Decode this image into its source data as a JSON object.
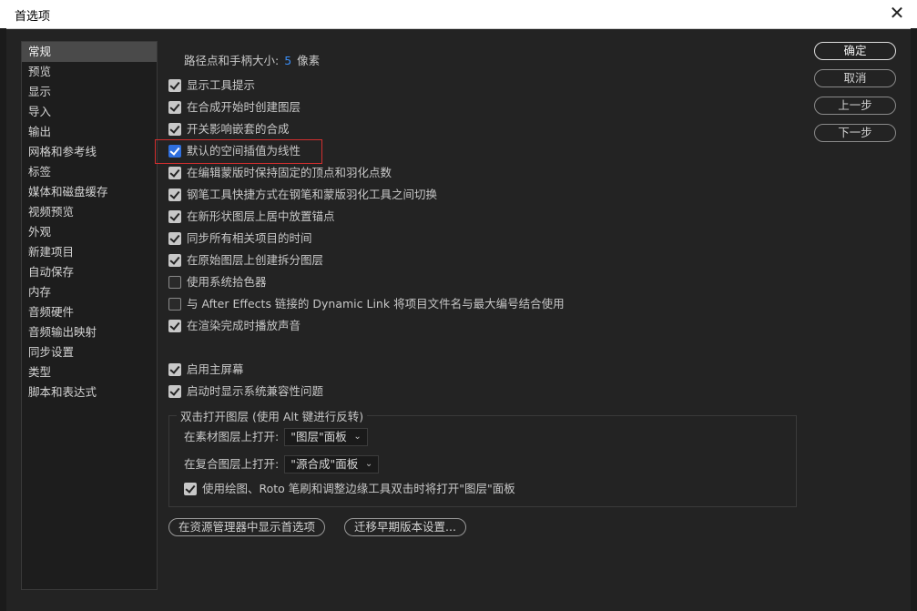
{
  "window": {
    "title": "首选项",
    "close_glyph": "✕"
  },
  "sidebar": {
    "items": [
      {
        "label": "常规",
        "selected": true
      },
      {
        "label": "预览"
      },
      {
        "label": "显示"
      },
      {
        "label": "导入"
      },
      {
        "label": "输出"
      },
      {
        "label": "网格和参考线"
      },
      {
        "label": "标签"
      },
      {
        "label": "媒体和磁盘缓存"
      },
      {
        "label": "视频预览"
      },
      {
        "label": "外观"
      },
      {
        "label": "新建项目"
      },
      {
        "label": "自动保存"
      },
      {
        "label": "内存"
      },
      {
        "label": "音频硬件"
      },
      {
        "label": "音频输出映射"
      },
      {
        "label": "同步设置"
      },
      {
        "label": "类型"
      },
      {
        "label": "脚本和表达式"
      }
    ]
  },
  "general": {
    "path_point_label": "路径点和手柄大小:",
    "path_point_value": "5",
    "path_point_unit": "像素",
    "checkboxes": [
      {
        "label": "显示工具提示",
        "checked": true
      },
      {
        "label": "在合成开始时创建图层",
        "checked": true
      },
      {
        "label": "开关影响嵌套的合成",
        "checked": true
      },
      {
        "label": "默认的空间插值为线性",
        "checked": true,
        "highlight": true
      },
      {
        "label": "在编辑蒙版时保持固定的顶点和羽化点数",
        "checked": true
      },
      {
        "label": "钢笔工具快捷方式在钢笔和蒙版羽化工具之间切换",
        "checked": true
      },
      {
        "label": "在新形状图层上居中放置锚点",
        "checked": true
      },
      {
        "label": "同步所有相关项目的时间",
        "checked": true
      },
      {
        "label": "在原始图层上创建拆分图层",
        "checked": true
      },
      {
        "label": "使用系统拾色器",
        "checked": false
      },
      {
        "label": "与 After Effects 链接的 Dynamic Link 将项目文件名与最大编号结合使用",
        "checked": false
      },
      {
        "label": "在渲染完成时播放声音",
        "checked": true
      }
    ],
    "checkboxes2": [
      {
        "label": "启用主屏幕",
        "checked": true
      },
      {
        "label": "启动时显示系统兼容性问题",
        "checked": true
      }
    ],
    "double_click_group": {
      "legend": "双击打开图层 (使用 Alt 键进行反转)",
      "footage_label": "在素材图层上打开:",
      "footage_value": "\"图层\"面板",
      "comp_label": "在复合图层上打开:",
      "comp_value": "\"源合成\"面板",
      "paint_label": "使用绘图、Roto 笔刷和调整边缘工具双击时将打开\"图层\"面板",
      "paint_checked": true
    },
    "reveal_button": "在资源管理器中显示首选项",
    "migrate_button": "迁移早期版本设置..."
  },
  "buttons": {
    "ok": "确定",
    "cancel": "取消",
    "prev": "上一步",
    "next": "下一步"
  },
  "colors": {
    "accent_blue": "#3b8ef7",
    "highlight_red": "#d22f2f",
    "checkbox_blue": "#2f6fde"
  }
}
